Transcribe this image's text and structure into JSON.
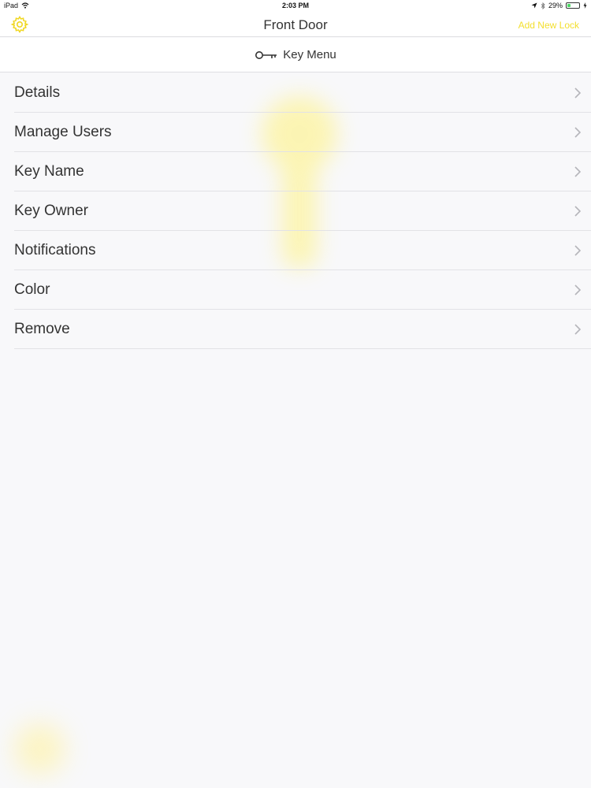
{
  "status_bar": {
    "device": "iPad",
    "time": "2:03 PM",
    "battery": "29%",
    "battery_level": 0.29,
    "icons": [
      "wifi-icon",
      "location-arrow-icon",
      "bluetooth-icon",
      "battery-icon",
      "charging-icon"
    ]
  },
  "navbar": {
    "title": "Front Door",
    "action_label": "Add New Lock",
    "left_icon": "gear-icon"
  },
  "key_menu": {
    "label": "Key Menu",
    "icon": "key-icon"
  },
  "menu": {
    "items": [
      {
        "label": "Details"
      },
      {
        "label": "Manage Users"
      },
      {
        "label": "Key Name"
      },
      {
        "label": "Key Owner"
      },
      {
        "label": "Notifications"
      },
      {
        "label": "Color"
      },
      {
        "label": "Remove"
      }
    ]
  },
  "colors": {
    "accent": "#f3df2d",
    "background": "#f8f8fa",
    "separator": "#e2e2e6"
  }
}
